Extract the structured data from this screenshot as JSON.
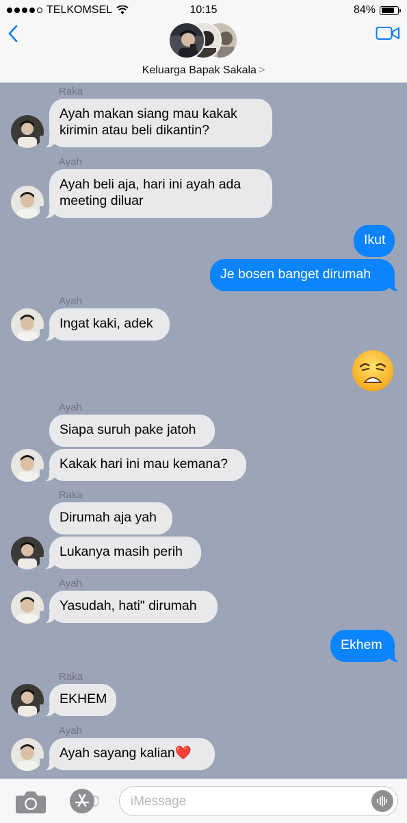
{
  "status_bar": {
    "carrier": "TELKOMSEL",
    "time": "10:15",
    "battery": "84%",
    "battery_level": 0.84
  },
  "header": {
    "group_name": "Keluarga Bapak Sakala",
    "chevron": ">"
  },
  "messages": {
    "m1": {
      "sender": "Raka",
      "lines": [
        "Ayah makan siang mau kakak",
        "kirimin atau beli dikantin?"
      ]
    },
    "m2": {
      "sender": "Ayah",
      "lines": [
        "Ayah beli aja, hari ini ayah ada",
        "meeting diluar"
      ]
    },
    "m3": {
      "text": "Ikut"
    },
    "m4": {
      "text": "Je bosen banget dirumah"
    },
    "m5": {
      "sender": "Ayah",
      "text": "Ingat kaki, adek"
    },
    "m6": {
      "emoji": "weary-face"
    },
    "m7": {
      "sender": "Ayah",
      "text": "Siapa suruh pake jatoh"
    },
    "m8": {
      "text": "Kakak hari ini mau kemana?"
    },
    "m9": {
      "sender": "Raka",
      "text": "Dirumah aja yah"
    },
    "m10": {
      "text": "Lukanya masih perih"
    },
    "m11": {
      "sender": "Ayah",
      "text": "Yasudah, hati\" dirumah"
    },
    "m12": {
      "text": "Ekhem"
    },
    "m13": {
      "sender": "Raka",
      "text": "EKHEM"
    },
    "m14": {
      "sender": "Ayah",
      "text": "Ayah sayang kalian❤️"
    }
  },
  "composer": {
    "placeholder": "iMessage"
  },
  "colors": {
    "thread_background": "#9ca5b8",
    "incoming_bubble": "#e9e9eb",
    "outgoing_bubble": "#0b84fe",
    "accent": "#0b7cf2"
  }
}
